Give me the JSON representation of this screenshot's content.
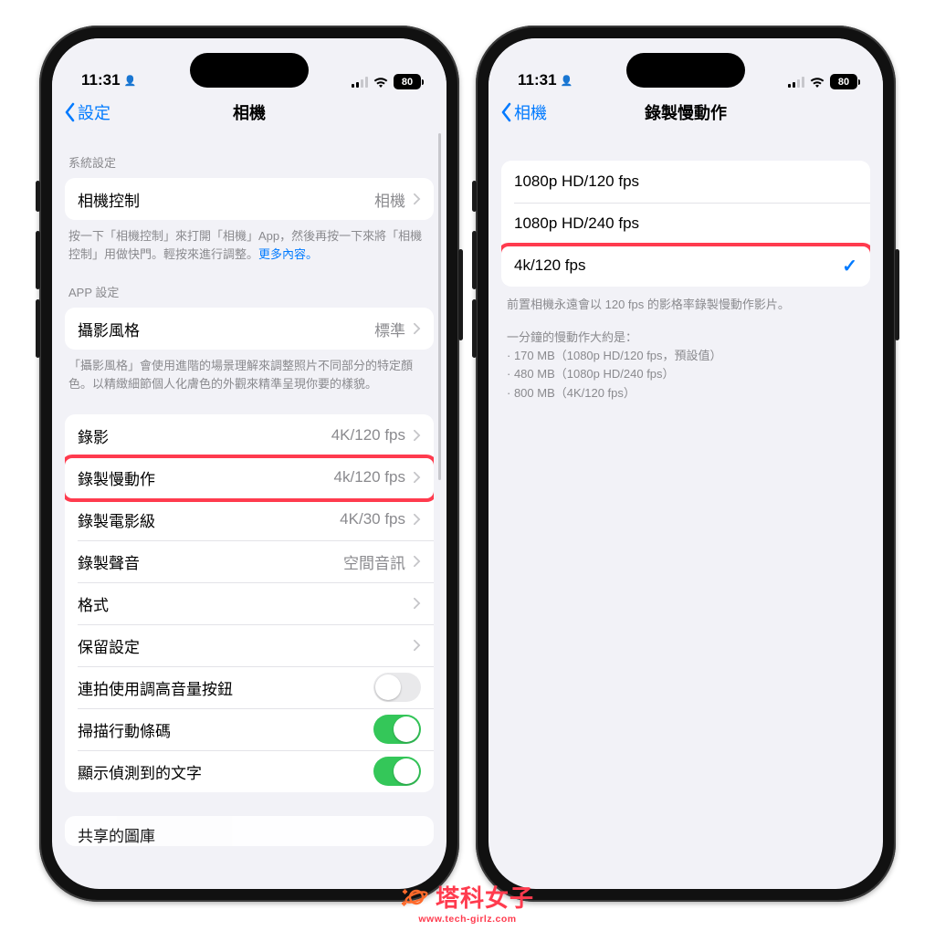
{
  "status": {
    "time": "11:31",
    "battery": "80"
  },
  "left": {
    "back": "設定",
    "title": "相機",
    "sec1_header": "系統設定",
    "sec1": {
      "camera_control_label": "相機控制",
      "camera_control_value": "相機"
    },
    "sec1_foot_a": "按一下「相機控制」來打開「相機」App，然後再按一下來將「相機控制」用做快門。輕按來進行調整。",
    "sec1_foot_link": "更多內容。",
    "sec2_header": "APP 設定",
    "sec2": {
      "style_label": "攝影風格",
      "style_value": "標準"
    },
    "sec2_foot": "「攝影風格」會使用進階的場景理解來調整照片不同部分的特定顏色。以精緻細節個人化膚色的外觀來精準呈現你要的樣貌。",
    "rows": {
      "record_video_label": "錄影",
      "record_video_value": "4K/120 fps",
      "slomo_label": "錄製慢動作",
      "slomo_value": "4k/120 fps",
      "cine_label": "錄製電影級",
      "cine_value": "4K/30 fps",
      "sound_label": "錄製聲音",
      "sound_value": "空間音訊",
      "format_label": "格式",
      "preserve_label": "保留設定",
      "burst_label": "連拍使用調高音量按鈕",
      "qr_label": "掃描行動條碼",
      "text_label": "顯示偵測到的文字"
    },
    "cut_row": "共享的圖庫"
  },
  "right": {
    "back": "相機",
    "title": "錄製慢動作",
    "opt1": "1080p HD/120 fps",
    "opt2": "1080p HD/240 fps",
    "opt3": "4k/120 fps",
    "foot1": "前置相機永遠會以 120 fps 的影格率錄製慢動作影片。",
    "foot2_head": "一分鐘的慢動作大約是：",
    "foot2_l1": "· 170 MB（1080p HD/120 fps，預設值）",
    "foot2_l2": "· 480 MB（1080p HD/240 fps）",
    "foot2_l3": "· 800 MB（4K/120 fps）"
  },
  "watermark": {
    "text": "塔科女子",
    "sub": "www.tech-girlz.com"
  }
}
